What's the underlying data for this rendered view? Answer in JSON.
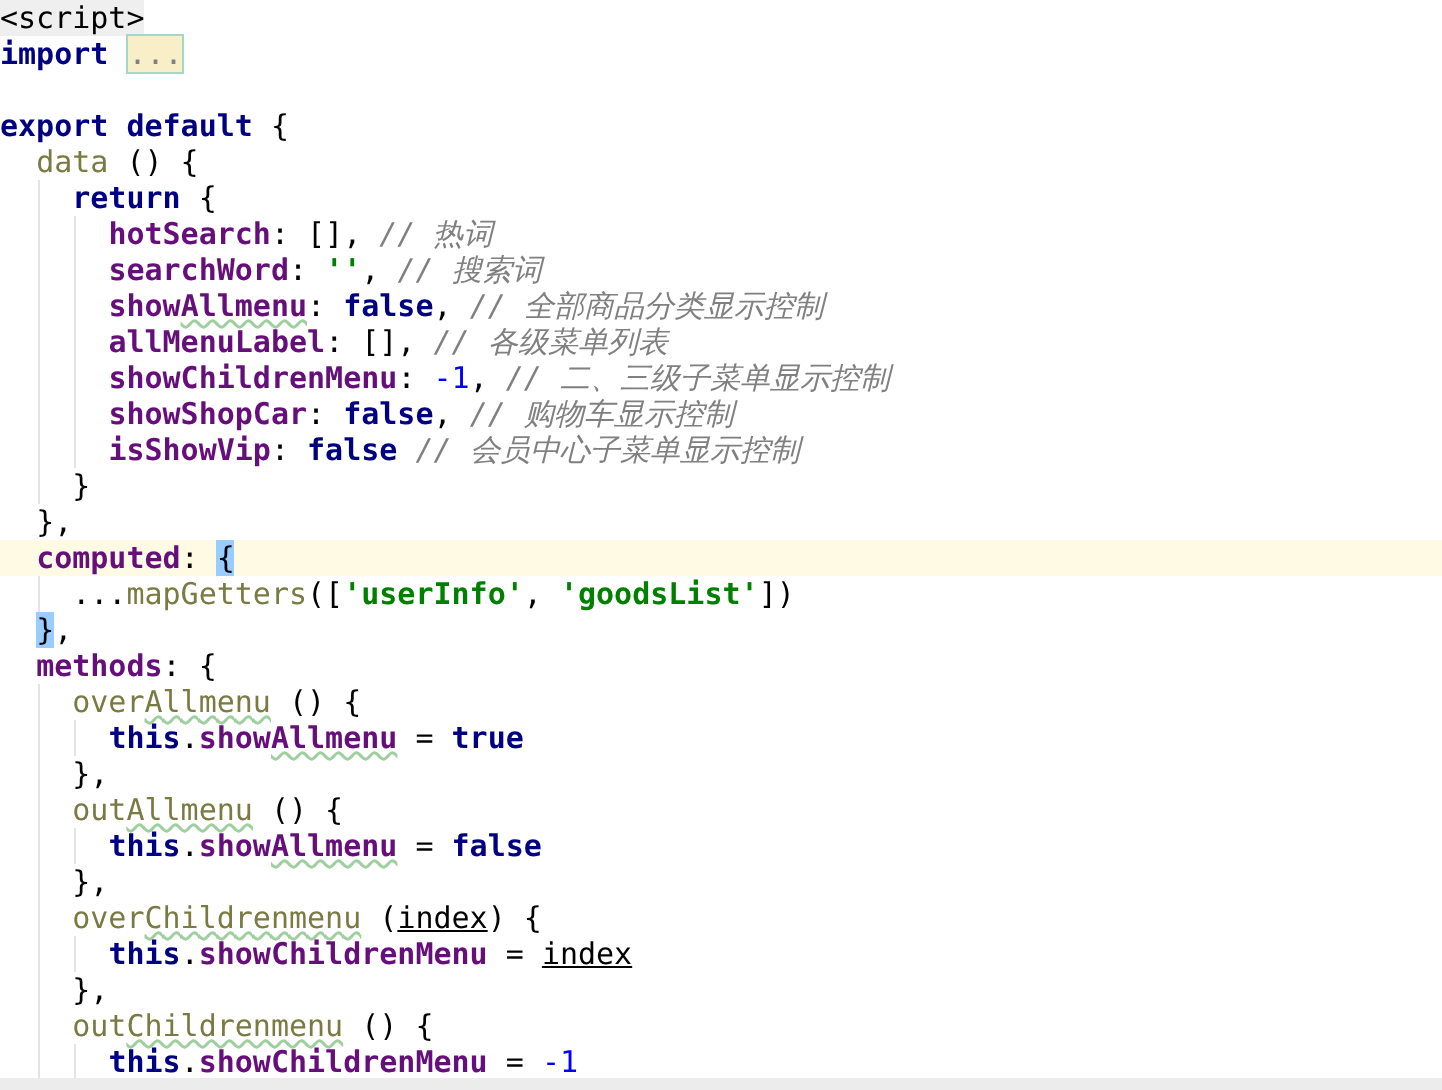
{
  "editor": {
    "lines": [
      {
        "current": false,
        "tokens": [
          {
            "kind": "tag",
            "text": "<script>"
          }
        ]
      },
      {
        "current": false,
        "tokens": [
          {
            "kind": "keyword",
            "text": "import "
          },
          {
            "kind": "fold",
            "text": "..."
          }
        ]
      },
      {
        "current": false
      },
      {
        "current": false,
        "tokens": [
          {
            "kind": "keyword",
            "text": "export default "
          },
          {
            "kind": "plain",
            "text": "{"
          }
        ]
      },
      {
        "current": false,
        "tokens": [
          {
            "kind": "method",
            "text": "  data"
          },
          {
            "kind": "plain",
            "text": " () {"
          }
        ]
      },
      {
        "current": false,
        "tokens": [
          {
            "kind": "keyword",
            "text": "    return "
          },
          {
            "kind": "plain",
            "text": "{"
          }
        ]
      },
      {
        "current": false,
        "tokens": [
          {
            "kind": "prop",
            "text": "      hotSearch"
          },
          {
            "kind": "plain",
            "text": ": [], "
          },
          {
            "kind": "comment",
            "text": "// 热词"
          }
        ]
      },
      {
        "current": false,
        "tokens": [
          {
            "kind": "prop",
            "text": "      searchWord"
          },
          {
            "kind": "plain",
            "text": ": "
          },
          {
            "kind": "string",
            "text": "''"
          },
          {
            "kind": "plain",
            "text": ", "
          },
          {
            "kind": "comment",
            "text": "// 搜索词"
          }
        ]
      },
      {
        "current": false,
        "tokens": [
          {
            "kind": "prop",
            "text": "      show"
          },
          {
            "kind": "prop",
            "text": "Allmenu",
            "typo": true
          },
          {
            "kind": "plain",
            "text": ": "
          },
          {
            "kind": "keyword",
            "text": "false"
          },
          {
            "kind": "plain",
            "text": ", "
          },
          {
            "kind": "comment",
            "text": "// 全部商品分类显示控制"
          }
        ]
      },
      {
        "current": false,
        "tokens": [
          {
            "kind": "prop",
            "text": "      allMenuLabel"
          },
          {
            "kind": "plain",
            "text": ": [], "
          },
          {
            "kind": "comment",
            "text": "// 各级菜单列表"
          }
        ]
      },
      {
        "current": false,
        "tokens": [
          {
            "kind": "prop",
            "text": "      showChildrenMenu"
          },
          {
            "kind": "plain",
            "text": ": "
          },
          {
            "kind": "number",
            "text": "-1"
          },
          {
            "kind": "plain",
            "text": ", "
          },
          {
            "kind": "comment",
            "text": "// 二、三级子菜单显示控制"
          }
        ]
      },
      {
        "current": false,
        "tokens": [
          {
            "kind": "prop",
            "text": "      showShopCar"
          },
          {
            "kind": "plain",
            "text": ": "
          },
          {
            "kind": "keyword",
            "text": "false"
          },
          {
            "kind": "plain",
            "text": ", "
          },
          {
            "kind": "comment",
            "text": "// 购物车显示控制"
          }
        ]
      },
      {
        "current": false,
        "tokens": [
          {
            "kind": "prop",
            "text": "      isShowVip"
          },
          {
            "kind": "plain",
            "text": ": "
          },
          {
            "kind": "keyword",
            "text": "false "
          },
          {
            "kind": "comment",
            "text": "// 会员中心子菜单显示控制"
          }
        ]
      },
      {
        "current": false,
        "tokens": [
          {
            "kind": "plain",
            "text": "    }"
          }
        ]
      },
      {
        "current": false,
        "tokens": [
          {
            "kind": "plain",
            "text": "  },"
          }
        ]
      },
      {
        "current": true,
        "tokens": [
          {
            "kind": "prop",
            "text": "  computed"
          },
          {
            "kind": "plain",
            "text": ": "
          },
          {
            "kind": "match",
            "text": "{"
          }
        ]
      },
      {
        "current": false,
        "tokens": [
          {
            "kind": "plain",
            "text": "    ..."
          },
          {
            "kind": "call",
            "text": "mapGetters"
          },
          {
            "kind": "plain",
            "text": "(["
          },
          {
            "kind": "string",
            "text": "'userInfo'"
          },
          {
            "kind": "plain",
            "text": ", "
          },
          {
            "kind": "string",
            "text": "'goodsList'"
          },
          {
            "kind": "plain",
            "text": "])"
          }
        ]
      },
      {
        "current": false,
        "tokens": [
          {
            "kind": "match",
            "text": "  }"
          },
          {
            "kind": "plain",
            "text": ","
          }
        ]
      },
      {
        "current": false,
        "tokens": [
          {
            "kind": "prop",
            "text": "  methods"
          },
          {
            "kind": "plain",
            "text": ": {"
          }
        ]
      },
      {
        "current": false,
        "tokens": [
          {
            "kind": "method",
            "text": "    over"
          },
          {
            "kind": "method",
            "text": "Allmenu",
            "typo": true
          },
          {
            "kind": "plain",
            "text": " () {"
          }
        ]
      },
      {
        "current": false,
        "tokens": [
          {
            "kind": "keyword",
            "text": "      this"
          },
          {
            "kind": "plain",
            "text": "."
          },
          {
            "kind": "prop",
            "text": "show"
          },
          {
            "kind": "prop",
            "text": "Allmenu",
            "typo": true
          },
          {
            "kind": "plain",
            "text": " = "
          },
          {
            "kind": "keyword",
            "text": "true"
          }
        ]
      },
      {
        "current": false,
        "tokens": [
          {
            "kind": "plain",
            "text": "    },"
          }
        ]
      },
      {
        "current": false,
        "tokens": [
          {
            "kind": "method",
            "text": "    out"
          },
          {
            "kind": "method",
            "text": "Allmenu",
            "typo": true
          },
          {
            "kind": "plain",
            "text": " () {"
          }
        ]
      },
      {
        "current": false,
        "tokens": [
          {
            "kind": "keyword",
            "text": "      this"
          },
          {
            "kind": "plain",
            "text": "."
          },
          {
            "kind": "prop",
            "text": "show"
          },
          {
            "kind": "prop",
            "text": "Allmenu",
            "typo": true
          },
          {
            "kind": "plain",
            "text": " = "
          },
          {
            "kind": "keyword",
            "text": "false"
          }
        ]
      },
      {
        "current": false,
        "tokens": [
          {
            "kind": "plain",
            "text": "    },"
          }
        ]
      },
      {
        "current": false,
        "tokens": [
          {
            "kind": "method",
            "text": "    over"
          },
          {
            "kind": "method",
            "text": "Childrenmenu",
            "typo": true
          },
          {
            "kind": "plain",
            "text": " ("
          },
          {
            "kind": "param",
            "text": "index"
          },
          {
            "kind": "plain",
            "text": ") {"
          }
        ]
      },
      {
        "current": false,
        "tokens": [
          {
            "kind": "keyword",
            "text": "      this"
          },
          {
            "kind": "plain",
            "text": "."
          },
          {
            "kind": "prop",
            "text": "showChildrenMenu"
          },
          {
            "kind": "plain",
            "text": " = "
          },
          {
            "kind": "param",
            "text": "index"
          }
        ]
      },
      {
        "current": false,
        "tokens": [
          {
            "kind": "plain",
            "text": "    },"
          }
        ]
      },
      {
        "current": false,
        "tokens": [
          {
            "kind": "method",
            "text": "    out"
          },
          {
            "kind": "method",
            "text": "Childrenmenu",
            "typo": true
          },
          {
            "kind": "plain",
            "text": " () {"
          }
        ]
      },
      {
        "current": false,
        "tokens": [
          {
            "kind": "keyword",
            "text": "      this"
          },
          {
            "kind": "plain",
            "text": "."
          },
          {
            "kind": "prop",
            "text": "showChildrenMenu"
          },
          {
            "kind": "plain",
            "text": " = "
          },
          {
            "kind": "number",
            "text": "-1"
          }
        ]
      }
    ]
  }
}
